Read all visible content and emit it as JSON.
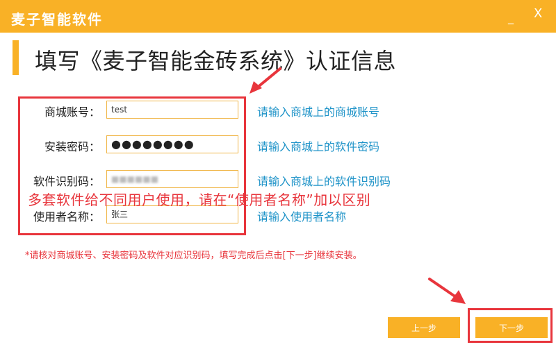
{
  "window": {
    "title": "麦子智能软件",
    "minimize_glyph": "_",
    "close_glyph": "X"
  },
  "heading": "填写《麦子智能金砖系统》认证信息",
  "form": {
    "fields": [
      {
        "label": "商城账号：",
        "value": "test",
        "hint": "请输入商城上的商城账号"
      },
      {
        "label": "安装密码：",
        "value": "●●●●●●●●",
        "hint": "请输入商城上的软件密码"
      },
      {
        "label": "软件识别码：",
        "value": "■■■■■■",
        "hint": "请输入商城上的软件识别码"
      },
      {
        "label": "使用者名称：",
        "value": "张三",
        "hint": "请输入使用者名称"
      }
    ]
  },
  "annotation": {
    "overlay_text": "多套软件给不同用户使用，请在“使用者名称”加以区别",
    "color": "#e8353c"
  },
  "notice": "*请核对商城账号、安装密码及软件对应识别码，填写完成后点击[下一步]继续安装。",
  "buttons": {
    "prev": "上一步",
    "next": "下一步"
  },
  "colors": {
    "accent": "#f9b126",
    "hint": "#1e93c8",
    "annotation": "#e8353c"
  }
}
